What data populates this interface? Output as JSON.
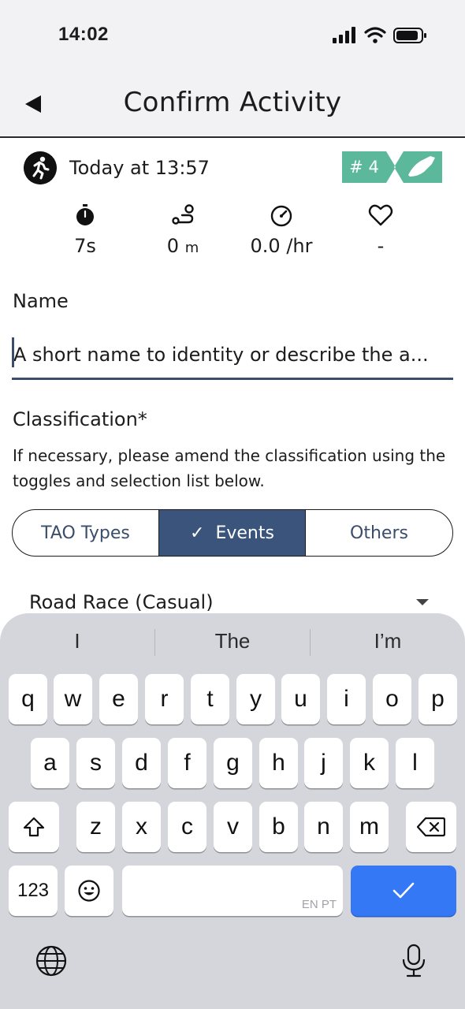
{
  "status_bar": {
    "time": "14:02"
  },
  "header": {
    "title": "Confirm Activity"
  },
  "activity": {
    "datetime": "Today at 13:57",
    "rank": "# 4",
    "stats": {
      "duration": "7s",
      "distance_value": "0",
      "distance_unit": "m",
      "pace": "0.0 /hr",
      "heart_rate": "-"
    }
  },
  "form": {
    "name_label": "Name",
    "name_placeholder": "A short name to identity or describe the a...",
    "classification_label": "Classification*",
    "classification_help": "If necessary, please amend the classification using the toggles and selection list below.",
    "segments": [
      "TAO Types",
      "Events",
      "Others"
    ],
    "selected_segment": "Events",
    "selected_category": "Road Race (Casual)"
  },
  "keyboard": {
    "suggestions": [
      "I",
      "The",
      "I’m"
    ],
    "row1": [
      "q",
      "w",
      "e",
      "r",
      "t",
      "y",
      "u",
      "i",
      "o",
      "p"
    ],
    "row2": [
      "a",
      "s",
      "d",
      "f",
      "g",
      "h",
      "j",
      "k",
      "l"
    ],
    "row3": [
      "z",
      "x",
      "c",
      "v",
      "b",
      "n",
      "m"
    ],
    "numbers_label": "123",
    "space_lang": "EN PT",
    "accent_color": "#3478f6"
  },
  "colors": {
    "primary": "#3a547c",
    "badge_green": "#5bb89a"
  }
}
